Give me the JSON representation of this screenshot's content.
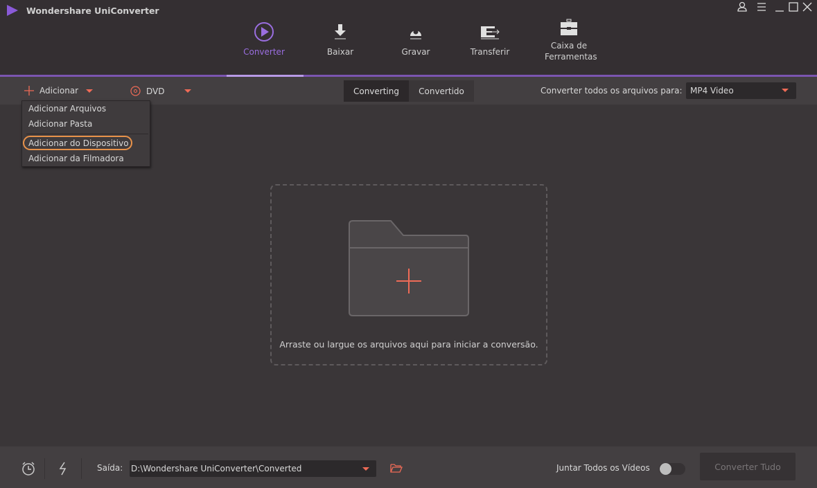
{
  "app": {
    "title": "Wondershare UniConverter"
  },
  "nav": [
    {
      "label": "Converter",
      "icon": "convert-icon",
      "active": true
    },
    {
      "label": "Baixar",
      "icon": "download-icon"
    },
    {
      "label": "Gravar",
      "icon": "burn-icon"
    },
    {
      "label": "Transferir",
      "icon": "transfer-icon"
    },
    {
      "label": "Caixa de Ferramentas",
      "icon": "toolbox-icon"
    }
  ],
  "toolbar": {
    "add_label": "Adicionar",
    "dvd_label": "DVD",
    "tabs": [
      "Converting",
      "Convertido"
    ],
    "convert_all_label": "Converter todos os arquivos para:",
    "format_value": "MP4 Video"
  },
  "menu": {
    "items": [
      "Adicionar Arquivos",
      "Adicionar Pasta",
      "Adicionar do Dispositivo",
      "Adicionar da Filmadora"
    ],
    "highlighted": "Adicionar do Dispositivo"
  },
  "dropzone": {
    "text": "Arraste ou largue os arquivos aqui para iniciar a conversão."
  },
  "bottom": {
    "output_label": "Saída:",
    "output_path": "D:\\Wondershare UniConverter\\Converted",
    "merge_label": "Juntar Todos os Vídeos",
    "merge_on": false,
    "convert_all_button": "Converter Tudo"
  },
  "colors": {
    "accent": "#7b55b0",
    "active_nav": "#9a6ee0",
    "orange": "#ef6b57",
    "highlight": "#e8924a"
  }
}
